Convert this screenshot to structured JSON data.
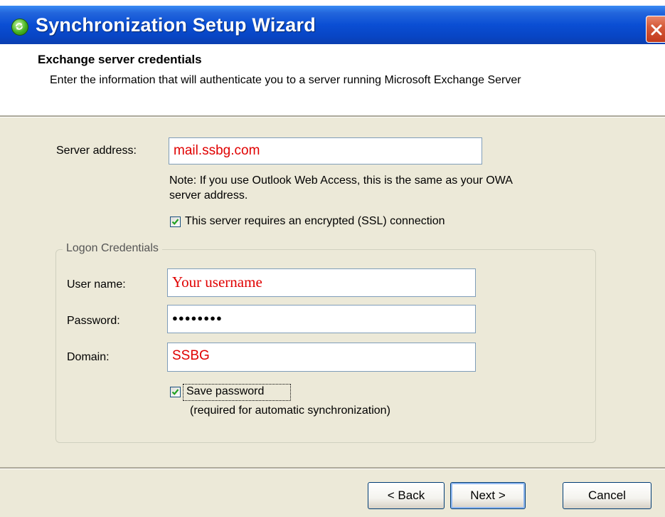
{
  "window": {
    "title": "Synchronization Setup Wizard"
  },
  "header": {
    "title": "Exchange server credentials",
    "description": "Enter the information that will authenticate you to a server running Microsoft Exchange Server"
  },
  "server": {
    "label": "Server address:",
    "value": "mail.ssbg.com",
    "note": "Note: If you use Outlook Web Access, this is the same as your OWA server address.",
    "ssl_label": "This server requires an encrypted (SSL) connection",
    "ssl_checked": true
  },
  "logon": {
    "group_title": "Logon Credentials",
    "username_label": "User name:",
    "username_value": "Your username",
    "password_label": "Password:",
    "password_value": "●●●●●●●●",
    "domain_label": "Domain:",
    "domain_value": "SSBG",
    "save_label": "Save password",
    "save_checked": true,
    "save_note": "(required for automatic synchronization)"
  },
  "buttons": {
    "back": "< Back",
    "next": "Next >",
    "cancel": "Cancel"
  },
  "colors": {
    "titlebar": "#0a4ed4",
    "dialog_bg": "#ece9d8",
    "field_text": "#e00000"
  },
  "icons": {
    "title": "sync-wizard-icon",
    "close": "close-icon",
    "check": "checkmark-icon"
  }
}
